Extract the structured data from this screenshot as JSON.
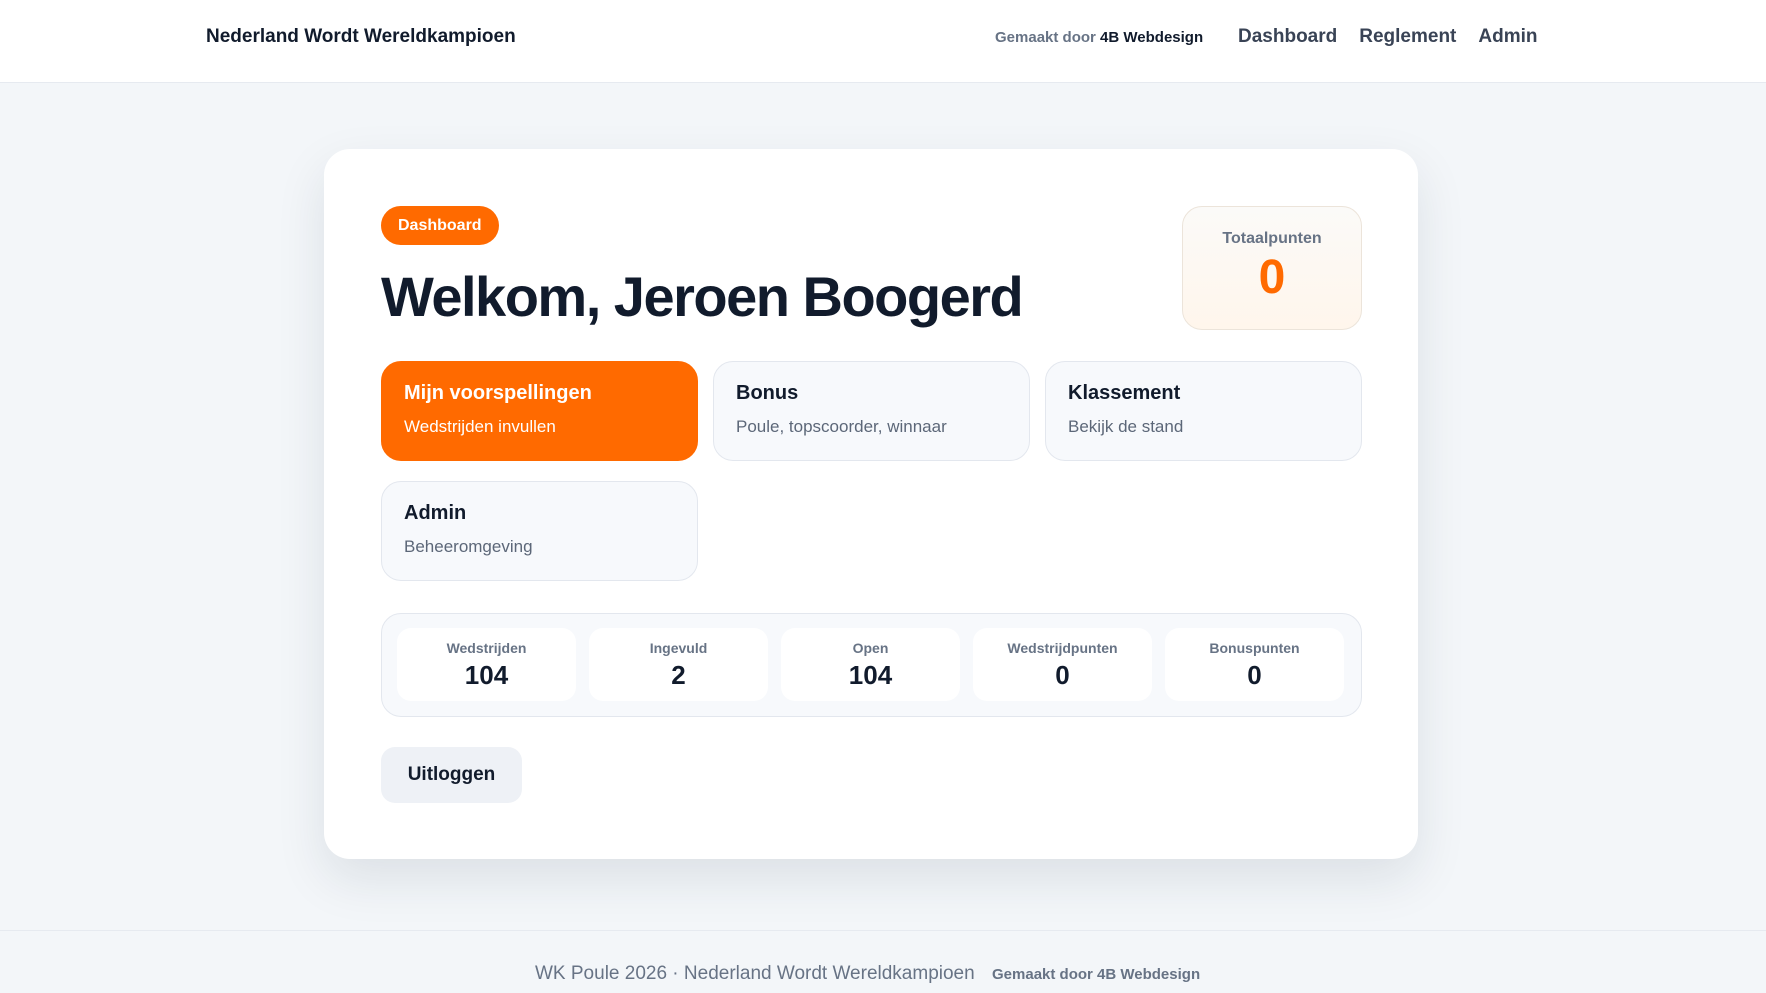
{
  "header": {
    "brand": "Nederland Wordt Wereldkampioen",
    "credit_prefix": "Gemaakt door",
    "credit_name": "4B Webdesign",
    "nav": [
      "Dashboard",
      "Reglement",
      "Admin"
    ]
  },
  "main": {
    "badge": "Dashboard",
    "welcome": "Welkom, Jeroen Boogerd",
    "total_points": {
      "label": "Totaalpunten",
      "value": "0"
    },
    "tiles": [
      {
        "title": "Mijn voorspellingen",
        "subtitle": "Wedstrijden invullen",
        "active": true
      },
      {
        "title": "Bonus",
        "subtitle": "Poule, topscoorder, winnaar",
        "active": false
      },
      {
        "title": "Klassement",
        "subtitle": "Bekijk de stand",
        "active": false
      },
      {
        "title": "Admin",
        "subtitle": "Beheeromgeving",
        "active": false
      }
    ],
    "stats": [
      {
        "label": "Wedstrijden",
        "value": "104"
      },
      {
        "label": "Ingevuld",
        "value": "2"
      },
      {
        "label": "Open",
        "value": "104"
      },
      {
        "label": "Wedstrijdpunten",
        "value": "0"
      },
      {
        "label": "Bonuspunten",
        "value": "0"
      }
    ],
    "logout_label": "Uitloggen"
  },
  "footer": {
    "text": "WK Poule 2026 · Nederland Wordt Wereldkampioen",
    "credit": "Gemaakt door 4B Webdesign"
  },
  "colors": {
    "accent": "#ff6a00",
    "text": "#111b2c",
    "muted": "#677385",
    "background": "#f3f6f9"
  }
}
